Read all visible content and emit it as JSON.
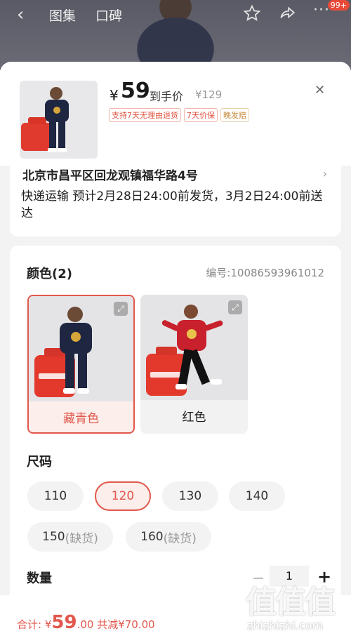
{
  "top": {
    "tabs": [
      "图集",
      "口碑"
    ],
    "badge": "99+"
  },
  "product": {
    "price_symbol": "¥",
    "price": "59",
    "price_label": "到手价",
    "original_price": "¥129",
    "tags": [
      "支持7天无理由退货",
      "7天价保",
      "晚发赔"
    ]
  },
  "address": {
    "line": "北京市昌平区回龙观镇福华路4号",
    "shipping": "快递运输 预计2月28日24:00前发货，3月2日24:00前送达"
  },
  "color": {
    "title": "颜色(2)",
    "sku": "编号:10086593961012",
    "options": [
      {
        "label": "藏青色",
        "selected": true,
        "garment": "#1f2642"
      },
      {
        "label": "红色",
        "selected": false,
        "garment": "#c8202c"
      }
    ]
  },
  "size": {
    "title": "尺码",
    "options": [
      {
        "label": "110",
        "oos": ""
      },
      {
        "label": "120",
        "oos": "",
        "selected": true
      },
      {
        "label": "130",
        "oos": ""
      },
      {
        "label": "140",
        "oos": ""
      },
      {
        "label": "150",
        "oos": "(缺货)"
      },
      {
        "label": "160",
        "oos": "(缺货)"
      }
    ]
  },
  "quantity": {
    "title": "数量",
    "value": "1"
  },
  "footer": {
    "total_label": "合计: ",
    "currency": "¥",
    "total_int": "59",
    "total_dec": ".00",
    "discount": " 共减¥70.00"
  },
  "watermark": {
    "chars": "值值值",
    "url": "zhizhizhi.com"
  },
  "colors": {
    "accent": "#e2574c"
  }
}
